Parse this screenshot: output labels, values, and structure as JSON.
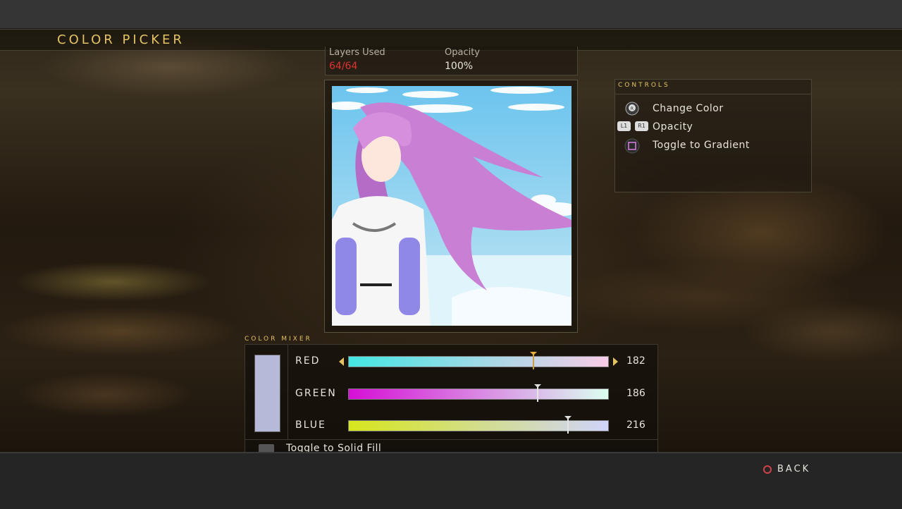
{
  "screen": {
    "title": "COLOR PICKER",
    "back_label": "BACK"
  },
  "stats": {
    "layers_label": "Layers Used",
    "layers_value": "64/64",
    "opacity_label": "Opacity",
    "opacity_value": "100%"
  },
  "controls": {
    "header": "CONTROLS",
    "items": [
      {
        "icon": "right-stick-icon",
        "label": "Change Color"
      },
      {
        "icon": "l1-r1-bumpers-icon",
        "label": "Opacity",
        "buttons": [
          "L1",
          "R1"
        ]
      },
      {
        "icon": "square-button-icon",
        "label": "Toggle to Gradient"
      }
    ]
  },
  "mixer": {
    "header": "COLOR MIXER",
    "swatch_color": "#B6BAD8",
    "channels": [
      {
        "name": "RED",
        "value": "182",
        "level": 0.714,
        "selected": true
      },
      {
        "name": "GREEN",
        "value": "186",
        "level": 0.729,
        "selected": false
      },
      {
        "name": "BLUE",
        "value": "216",
        "level": 0.847,
        "selected": false
      }
    ],
    "toggle_label": "Toggle to Solid Fill"
  },
  "colors": {
    "accent": "#E3C363",
    "warning": "#E03030",
    "back_circle": "#D2414A",
    "red_bar": [
      "#44E6E4",
      "#F8CCE8"
    ],
    "green_bar": [
      "#D60ED6",
      "#DCFFF0"
    ],
    "blue_bar": [
      "#D6E61C",
      "#D0D4FA"
    ]
  }
}
